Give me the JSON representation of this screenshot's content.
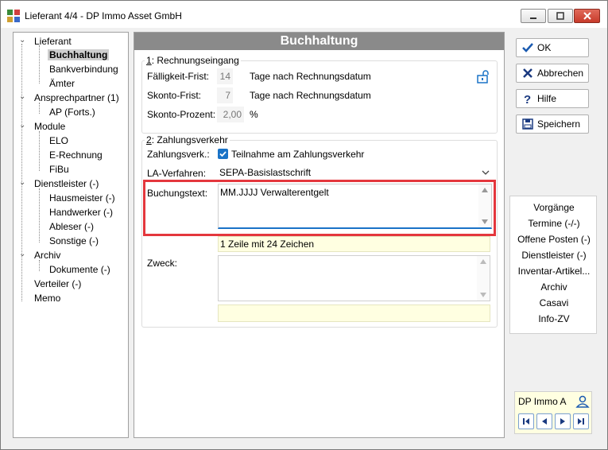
{
  "window": {
    "title": "Lieferant 4/4 - DP Immo Asset GmbH"
  },
  "tree": {
    "items": [
      {
        "label": "Lieferant"
      },
      {
        "label": "Buchhaltung"
      },
      {
        "label": "Bankverbindung"
      },
      {
        "label": "Ämter"
      },
      {
        "label": "Ansprechpartner (1)"
      },
      {
        "label": "AP (Forts.)"
      },
      {
        "label": "Module"
      },
      {
        "label": "ELO"
      },
      {
        "label": "E-Rechnung"
      },
      {
        "label": "FiBu"
      },
      {
        "label": "Dienstleister (-)"
      },
      {
        "label": "Hausmeister (-)"
      },
      {
        "label": "Handwerker (-)"
      },
      {
        "label": "Ableser (-)"
      },
      {
        "label": "Sonstige (-)"
      },
      {
        "label": "Archiv"
      },
      {
        "label": "Dokumente (-)"
      },
      {
        "label": "Verteiler (-)"
      },
      {
        "label": "Memo"
      }
    ]
  },
  "main": {
    "header": "Buchhaltung",
    "section1": {
      "title_num": "1",
      "title_rest": ": Rechnungseingang",
      "faelligkeit_label": "Fälligkeit-Frist:",
      "faelligkeit_value": "14",
      "faelligkeit_unit": "Tage nach Rechnungsdatum",
      "skonto_frist_label": "Skonto-Frist:",
      "skonto_frist_value": "7",
      "skonto_frist_unit": "Tage nach Rechnungsdatum",
      "skonto_prozent_label": "Skonto-Prozent:",
      "skonto_prozent_value": "2,00",
      "skonto_prozent_unit": "%"
    },
    "section2": {
      "title_num": "2",
      "title_rest": ": Zahlungsverkehr",
      "zahlungsverk_label": "Zahlungsverk.:",
      "zahlungsverk_checkbox": "Teilnahme am Zahlungsverkehr",
      "la_label": "LA-Verfahren:",
      "la_value": "SEPA-Basislastschrift",
      "buchungstext_label": "Buchungstext:",
      "buchungstext_value": "MM.JJJJ Verwalterentgelt",
      "buchungstext_info": "1 Zeile mit 24 Zeichen",
      "zweck_label": "Zweck:",
      "zweck_value": "",
      "zweck_info": ""
    }
  },
  "buttons": {
    "ok": "OK",
    "abbrechen": "Abbrechen",
    "hilfe": "Hilfe",
    "speichern": "Speichern"
  },
  "links": [
    "Vorgänge",
    "Termine (-/-)",
    "Offene Posten (-)",
    "Dienstleister (-)",
    "Inventar-Artikel...",
    "Archiv",
    "Casavi",
    "Info-ZV"
  ],
  "nav": {
    "label": "DP Immo A"
  },
  "colors": {
    "highlight": "#e4373d",
    "accent": "#1a73c7",
    "header": "#8a8a8a"
  }
}
